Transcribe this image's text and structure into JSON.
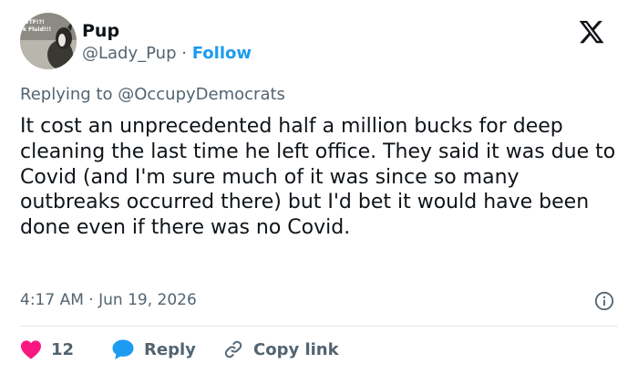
{
  "author": {
    "display_name": "Pup",
    "handle": "@Lady_Pup",
    "separator": "·",
    "follow_label": "Follow",
    "avatar_text": [
      "WTF!?!",
      "k Fluid!!!"
    ]
  },
  "reply": {
    "prefix": "Replying to",
    "mention": "@OccupyDemocrats"
  },
  "tweet": {
    "text": "It cost an unprecedented half a million bucks for deep cleaning the last time he left office. They said it was due to Covid (and I'm sure much of it was since so many outbreaks occurred there) but I'd bet it would have been done even if there was no Covid."
  },
  "meta": {
    "time": "4:17 AM",
    "separator": "·",
    "date": "Jun 19, 2026"
  },
  "actions": {
    "like_count": "12",
    "reply_label": "Reply",
    "copy_link_label": "Copy link"
  },
  "colors": {
    "accent": "#1d9bf0",
    "heart": "#f91880",
    "text": "#0f1419",
    "muted": "#536471",
    "divider": "#e1e8ed"
  },
  "icons": {
    "brand": "x-logo-icon",
    "info": "info-icon",
    "like": "heart-icon",
    "reply": "speech-bubble-icon",
    "copy": "link-icon"
  }
}
